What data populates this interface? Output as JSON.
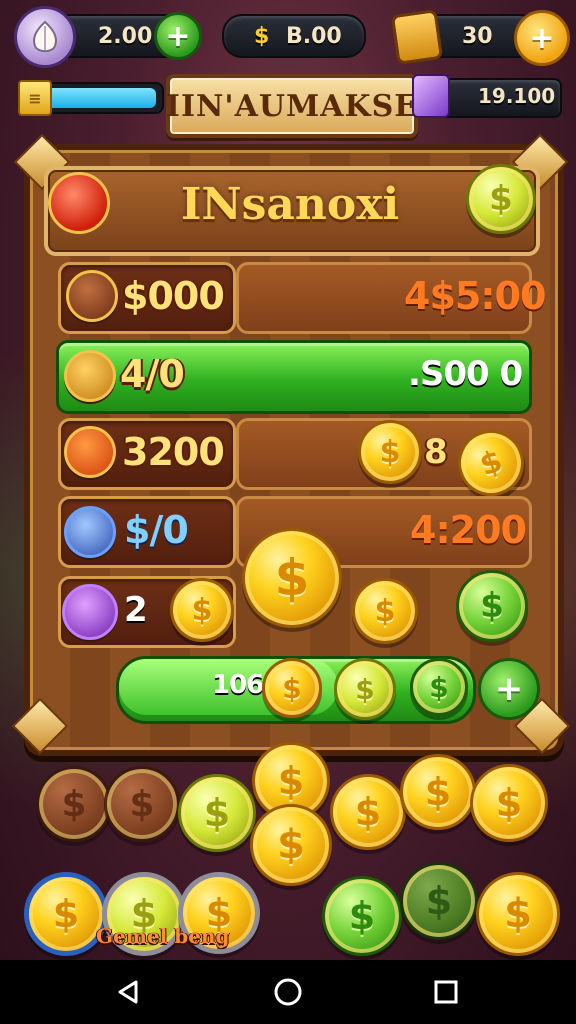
{
  "top_bar": {
    "lives": "2.00",
    "coins": "B.00",
    "coin_symbol": "$",
    "tickets": "30",
    "add_symbol": "+"
  },
  "title_plate": "IIN'AUMAKSE",
  "gems": "19.100",
  "panel": {
    "title": "INsanoxi",
    "rows": [
      {
        "left": "$000",
        "right": "4$5:00"
      },
      {
        "left": "4/0",
        "right": ".S00 0"
      },
      {
        "left": "3200",
        "right": "8"
      },
      {
        "left": "$/0",
        "right": "4:200"
      },
      {
        "left": "2"
      }
    ],
    "progress": {
      "value_label": "106",
      "fraction": 0.62,
      "add_symbol": "+"
    }
  },
  "bottom": {
    "label": "Gemel beng"
  },
  "coin_glyph": "$",
  "colors": {
    "gold": "#ffd21e",
    "green": "#2fb11f",
    "wood": "#8b4f22"
  },
  "navbar": {
    "back": "back-icon",
    "home": "home-icon",
    "recents": "recents-icon"
  }
}
